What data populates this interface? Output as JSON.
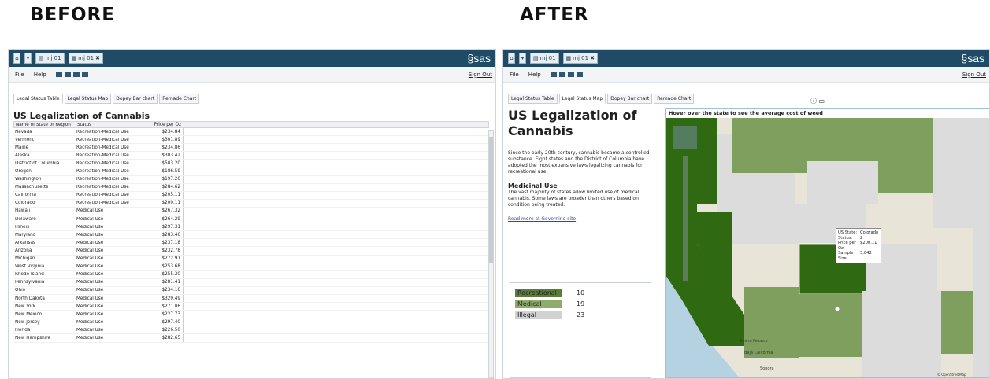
{
  "headings": {
    "before": "BEFORE",
    "after": "AFTER"
  },
  "app": {
    "home_icon": "home-icon",
    "tab1": "mj 01",
    "tab2": "mj 01",
    "logo": "§sas",
    "menu": {
      "file": "File",
      "help": "Help",
      "sign_out": "Sign Out"
    },
    "tabs": [
      "Legal Status Table",
      "Legal Status Map",
      "Dopey Bar chart",
      "Remade Chart"
    ]
  },
  "table": {
    "title": "US Legalization of Cannabis",
    "headers": [
      "Name of State or Region",
      "Status",
      "Price per Oz"
    ],
    "rows": [
      [
        "Nevada",
        "Recreation-Medical Use",
        "$234.84"
      ],
      [
        "Vermont",
        "Recreation-Medical Use",
        "$301.89"
      ],
      [
        "Maine",
        "Recreation-Medical Use",
        "$234.86"
      ],
      [
        "Alaska",
        "Recreation-Medical Use",
        "$303.42"
      ],
      [
        "District of Columbia",
        "Recreation-Medical Use",
        "$503.20"
      ],
      [
        "Oregon",
        "Recreation-Medical Use",
        "$186.59"
      ],
      [
        "Washington",
        "Recreation-Medical Use",
        "$197.20"
      ],
      [
        "Massachusetts",
        "Recreation-Medical Use",
        "$284.62"
      ],
      [
        "California",
        "Recreation-Medical Use",
        "$205.11"
      ],
      [
        "Colorado",
        "Recreation-Medical Use",
        "$200.11"
      ],
      [
        "Hawaii",
        "Medical Use",
        "$267.32"
      ],
      [
        "Delaware",
        "Medical Use",
        "$264.29"
      ],
      [
        "Illinois",
        "Medical Use",
        "$297.31"
      ],
      [
        "Maryland",
        "Medical Use",
        "$283.46"
      ],
      [
        "Arkansas",
        "Medical Use",
        "$237.18"
      ],
      [
        "Arizona",
        "Medical Use",
        "$232.78"
      ],
      [
        "Michigan",
        "Medical Use",
        "$272.91"
      ],
      [
        "West Virginia",
        "Medical Use",
        "$253.68"
      ],
      [
        "Rhode Island",
        "Medical Use",
        "$255.30"
      ],
      [
        "Pennsylvania",
        "Medical Use",
        "$281.41"
      ],
      [
        "Ohio",
        "Medical Use",
        "$234.16"
      ],
      [
        "North Dakota",
        "Medical Use",
        "$329.49"
      ],
      [
        "New York",
        "Medical Use",
        "$271.06"
      ],
      [
        "New Mexico",
        "Medical Use",
        "$227.73"
      ],
      [
        "New Jersey",
        "Medical Use",
        "$297.40"
      ],
      [
        "Florida",
        "Medical Use",
        "$226.50"
      ],
      [
        "New Hampshire",
        "Medical Use",
        "$282.65"
      ]
    ]
  },
  "info": {
    "title": "US Legalization of Cannabis",
    "intro": "Since the early 20th century, cannabis became a controlled substance. Eight states and the District of Columbia have adopted the most expansive laws legalizing cannabis for recreational use.",
    "medical_heading": "Medicinal Use",
    "medical_text": "The vast majority of states allow limited use of medical cannabis. Some laws are broader than others based on condition being treated.",
    "link": "Read more at Governing site"
  },
  "legend": [
    {
      "label": "Recreational",
      "count": "10",
      "color": "#5b7d3a"
    },
    {
      "label": "Medical",
      "count": "19",
      "color": "#8fac6c"
    },
    {
      "label": "Illegal",
      "count": "23",
      "color": "#d2d2d2"
    }
  ],
  "map": {
    "title": "Hover over the state to see the average cost of weed",
    "tooltip": {
      "labels": [
        "US State:",
        "Status:",
        "Price per Oz:",
        "Sample Size:"
      ],
      "values": [
        "Colorado",
        "2",
        "$200.11",
        "3,842"
      ]
    },
    "places": [
      "Baja California",
      "Sonora",
      "Puerto Peñasco",
      "© OpenStreetMap"
    ],
    "colors": {
      "recreational": "#2f6a12",
      "medical": "#7f9f5e",
      "illegal": "#dcdcdc",
      "water": "#b5d2e2",
      "land": "#e8e4d8"
    }
  }
}
